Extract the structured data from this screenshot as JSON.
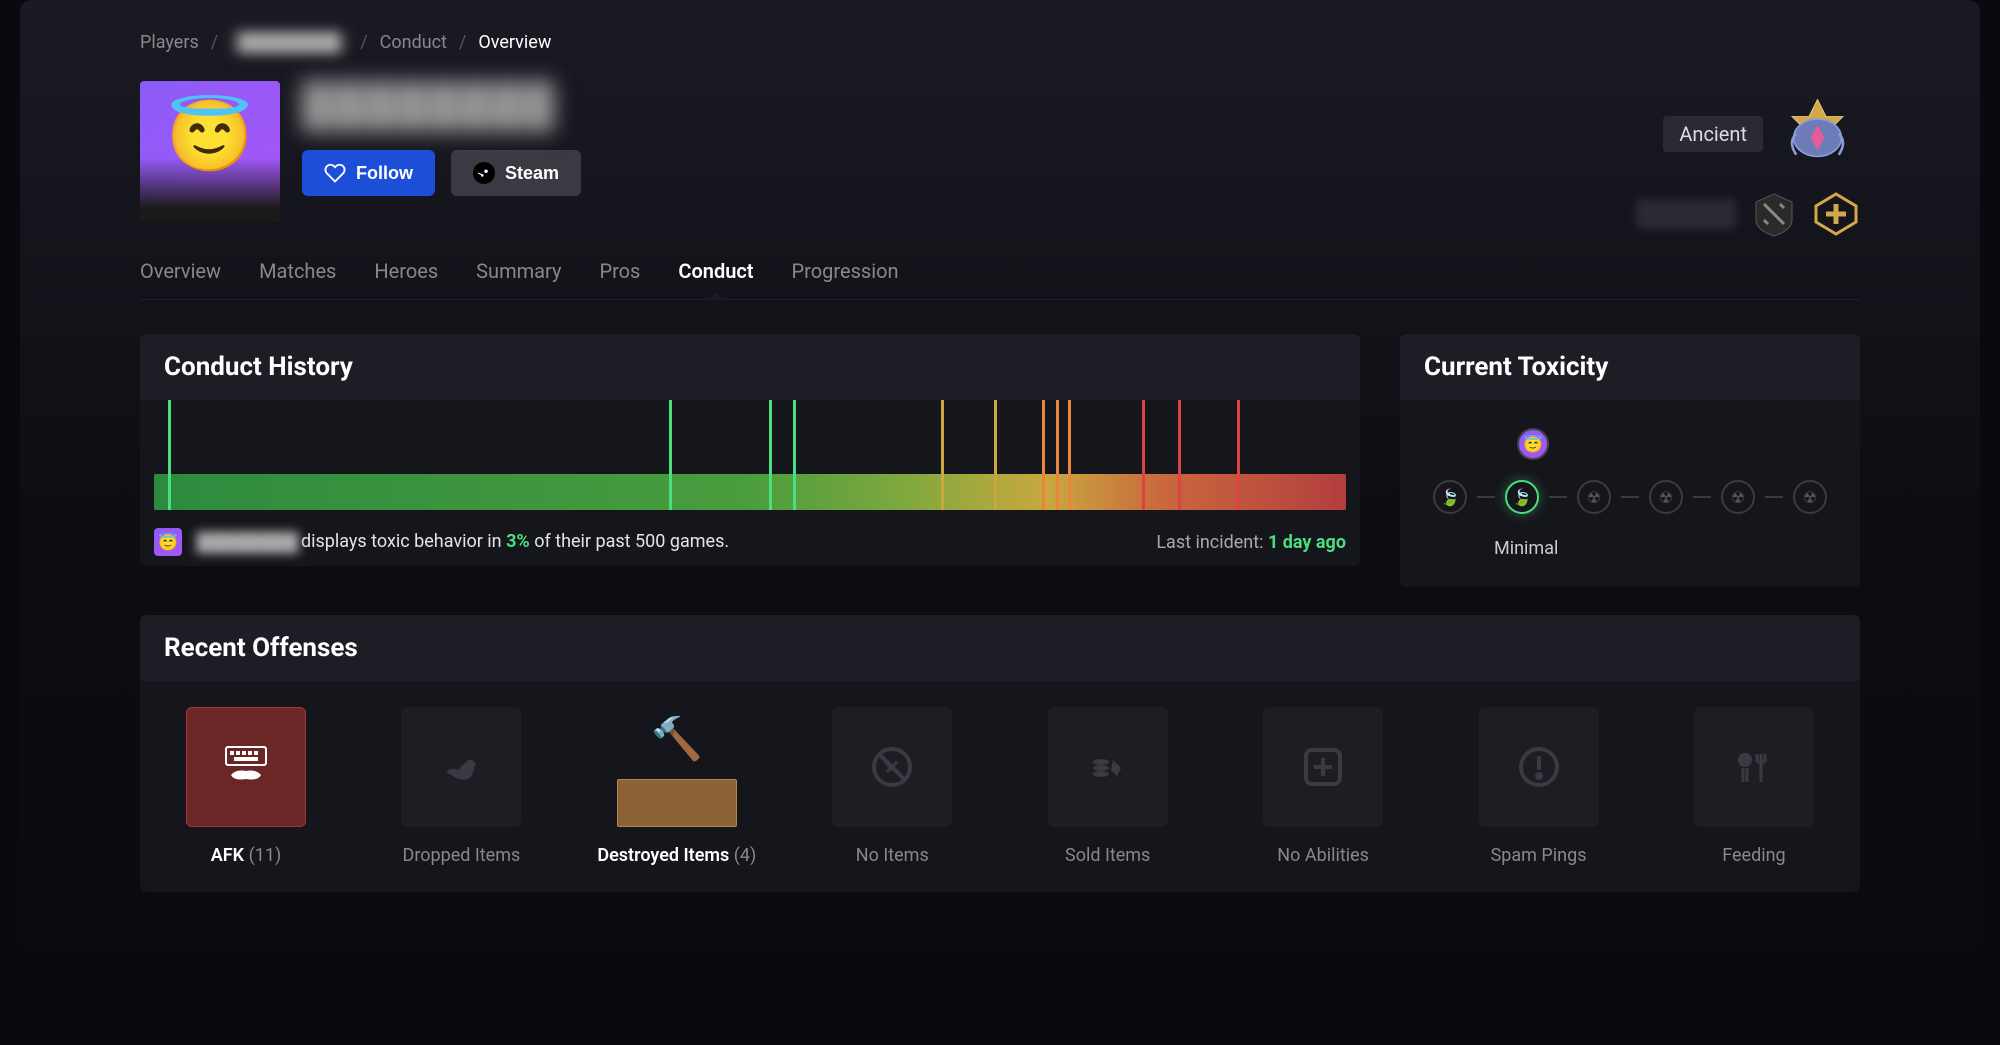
{
  "breadcrumb": {
    "root": "Players",
    "player_blur": "████████",
    "section": "Conduct",
    "page": "Overview"
  },
  "profile": {
    "player_name_blur": "████████",
    "follow_label": "Follow",
    "steam_label": "Steam",
    "rank_label": "Ancient",
    "login_blur": "Login To Do"
  },
  "tabs": [
    "Overview",
    "Matches",
    "Heroes",
    "Summary",
    "Pros",
    "Conduct",
    "Progression"
  ],
  "active_tab": "Conduct",
  "conduct_history": {
    "title": "Conduct History",
    "summary_prefix": "displays toxic behavior in",
    "summary_pct": "3%",
    "summary_suffix": "of their past 500 games.",
    "last_incident_label": "Last incident:",
    "last_incident_value": "1 day ago"
  },
  "toxicity": {
    "title": "Current Toxicity",
    "level_label": "Minimal",
    "active_index": 1,
    "scale_count": 6
  },
  "offenses": {
    "title": "Recent Offenses",
    "items": [
      {
        "label": "AFK",
        "count": 11,
        "style": "red",
        "icon": "keyboard"
      },
      {
        "label": "Dropped Items",
        "count": null,
        "style": "dim",
        "icon": "drop"
      },
      {
        "label": "Destroyed Items",
        "count": 4,
        "style": "brown",
        "icon": "destroy"
      },
      {
        "label": "No Items",
        "count": null,
        "style": "dim",
        "icon": "noitems"
      },
      {
        "label": "Sold Items",
        "count": null,
        "style": "dim",
        "icon": "sold"
      },
      {
        "label": "No Abilities",
        "count": null,
        "style": "dim",
        "icon": "noabilities"
      },
      {
        "label": "Spam Pings",
        "count": null,
        "style": "dim",
        "icon": "ping"
      },
      {
        "label": "Feeding",
        "count": null,
        "style": "dim",
        "icon": "feeding"
      }
    ]
  },
  "chart_data": {
    "type": "bar",
    "title": "Conduct History",
    "xlabel": "",
    "ylabel": "",
    "description": "500-game toxic-incident timeline. Gradient bar green→red with vertical spikes at incident positions.",
    "gradient_stops": [
      {
        "pos": 0,
        "color": "#2d8a3e"
      },
      {
        "pos": 50,
        "color": "#4a9d3e"
      },
      {
        "pos": 63,
        "color": "#7fa83e"
      },
      {
        "pos": 75,
        "color": "#c9a83e"
      },
      {
        "pos": 85,
        "color": "#c9663e"
      },
      {
        "pos": 100,
        "color": "#b33e3e"
      }
    ],
    "spikes": [
      {
        "pos_pct": 1.2,
        "severity": "green"
      },
      {
        "pos_pct": 43.5,
        "severity": "green"
      },
      {
        "pos_pct": 52.0,
        "severity": "green"
      },
      {
        "pos_pct": 54.0,
        "severity": "green"
      },
      {
        "pos_pct": 66.5,
        "severity": "yellow"
      },
      {
        "pos_pct": 71.0,
        "severity": "yellow"
      },
      {
        "pos_pct": 75.0,
        "severity": "orange"
      },
      {
        "pos_pct": 76.2,
        "severity": "orange"
      },
      {
        "pos_pct": 77.2,
        "severity": "orange"
      },
      {
        "pos_pct": 83.5,
        "severity": "red"
      },
      {
        "pos_pct": 86.5,
        "severity": "red"
      },
      {
        "pos_pct": 91.5,
        "severity": "red"
      }
    ]
  }
}
